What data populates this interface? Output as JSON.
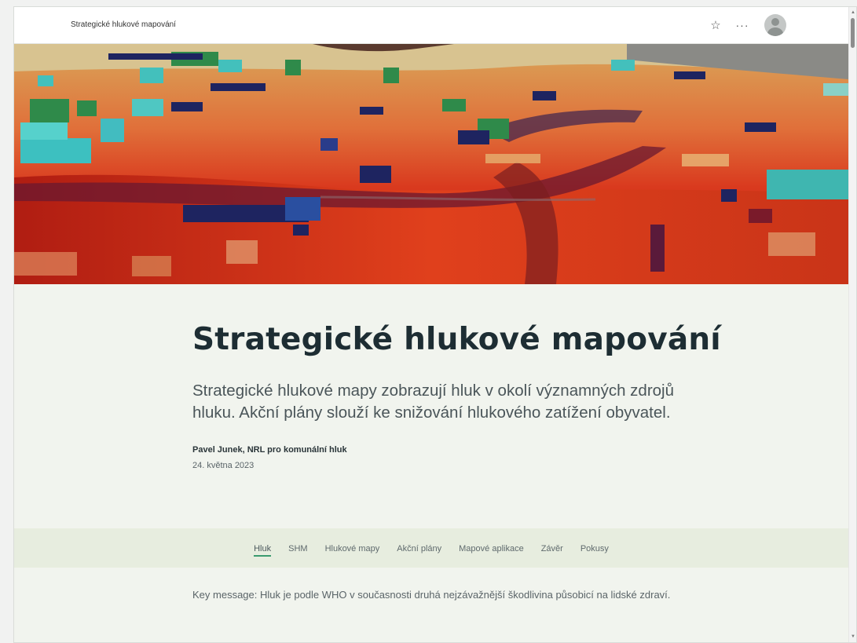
{
  "app": {
    "title": "Strategické hlukové mapování"
  },
  "toolbar": {
    "favorite_icon": "star-icon",
    "more_icon": "more-options-icon",
    "avatar_icon": "user-avatar-icon"
  },
  "hero": {
    "image": "3D noise map of terrain and buildings (red/orange noise levels)"
  },
  "article": {
    "title": "Strategické hlukové mapování",
    "lead": "Strategické hlukové mapy zobrazují hluk v okolí významných zdrojů hluku. Akční plány slouží ke snižování hlukového zatížení obyvatel.",
    "author": "Pavel Junek, NRL pro komunální hluk",
    "date": "24. května 2023"
  },
  "nav": {
    "items": [
      {
        "label": "Hluk",
        "active": true
      },
      {
        "label": "SHM"
      },
      {
        "label": "Hlukové mapy"
      },
      {
        "label": "Akční plány"
      },
      {
        "label": "Mapové aplikace"
      },
      {
        "label": "Závěr"
      },
      {
        "label": "Pokusy"
      }
    ],
    "active_color": "#3a9b6f"
  },
  "body": {
    "key_message": "Key message: Hluk je podle WHO v současnosti druhá nejzávažnější škodlivina působicí na lidské zdraví."
  },
  "colors": {
    "background": "#f1f4ee",
    "nav_band": "#e7eddf",
    "title": "#1d2d33"
  }
}
